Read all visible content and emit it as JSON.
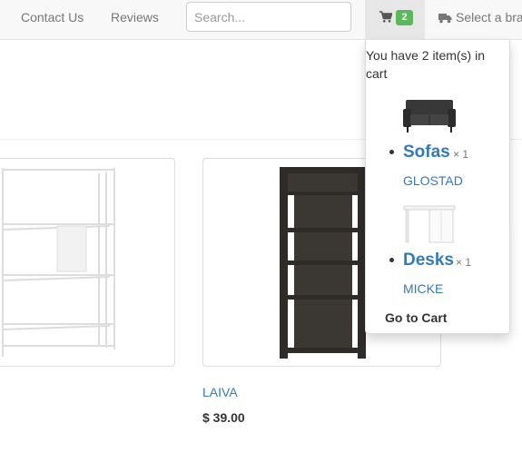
{
  "nav": {
    "contact_us": "Contact Us",
    "reviews": "Reviews",
    "search_placeholder": "Search...",
    "cart_count": "2",
    "cart_icon": "shopping-cart-icon",
    "brand_icon": "truck-icon",
    "brand_label": "Select a bra"
  },
  "products": [
    {
      "name": "",
      "price": ""
    },
    {
      "name": "LAIVA",
      "price": "$ 39.00"
    }
  ],
  "cart": {
    "header": "You have 2 item(s) in cart",
    "items": [
      {
        "category": "Sofas",
        "qty": "× 1",
        "name": "GLOSTAD"
      },
      {
        "category": "Desks",
        "qty": "× 1",
        "name": "MICKE"
      }
    ],
    "go_to_cart": "Go to Cart"
  },
  "colors": {
    "link": "#337ab7",
    "badge": "#5cb85c",
    "nav_bg": "#f8f8f8"
  }
}
